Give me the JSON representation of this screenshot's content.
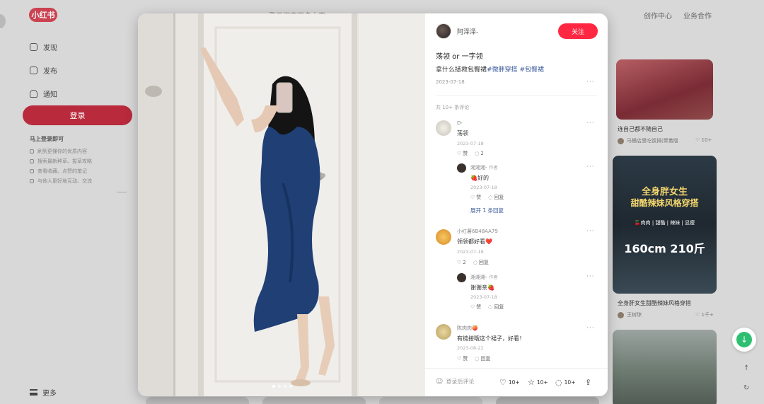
{
  "app": {
    "logo": "小红书"
  },
  "topnav": {
    "search_placeholder": "登录探索更多内容",
    "creator": "创作中心",
    "business": "业务合作"
  },
  "sidebar": {
    "items": [
      {
        "label": "发现",
        "icon": "home-icon"
      },
      {
        "label": "发布",
        "icon": "plus-square-icon"
      },
      {
        "label": "通知",
        "icon": "bell-icon"
      }
    ],
    "login_button": "登录",
    "login_tip_title": "马上登录即可",
    "login_tips": [
      "刷到更懂你的优质内容",
      "搜索最新种草、拔草攻略",
      "查看收藏、点赞的笔记",
      "与他人更好地互动、交流"
    ],
    "more": "更多"
  },
  "feed": {
    "cards": [
      {
        "title": "连自己都不随自己",
        "author": "马桶店里吃饭捐(聚着版",
        "likes": "10+"
      },
      {
        "banner_line1": "全身胖女生",
        "banner_line2": "甜酷辣妹风格穿搭",
        "banner_tags": "🍒肉肉 | 甜酷 | 辣妹 | 显瘦",
        "banner_size": "160cm 210斤",
        "title": "全身肝女生甜酷辣妹风格穿搭",
        "author": "王树琼",
        "likes": "1千+"
      }
    ]
  },
  "note": {
    "author": {
      "name": "阿泽泽-"
    },
    "follow_label": "关注",
    "title": "荡领 or 一字领",
    "body_text": "拿什么拯救包臀裙",
    "tags": [
      "#微胖穿搭",
      "#包臀裙"
    ],
    "date": "2023-07-18",
    "more": "···",
    "comment_count": "共 10+ 条评论",
    "comments": [
      {
        "name": "D-",
        "text": "荡领",
        "date": "2023-07-18",
        "likes": "赞",
        "replies": "2",
        "reply": {
          "name": "湘湘湘-",
          "author_tag": "作者",
          "text": "🍓好的",
          "date": "2023-07-18",
          "likes": "赞",
          "reply_label": "回复"
        },
        "expand": "展开 1 条回复"
      },
      {
        "name": "小红薯6B48AA79",
        "text": "领领都好看❤️",
        "date": "2023-07-18",
        "likes": "2",
        "replies": "回复",
        "reply": {
          "name": "湘湘湘-",
          "author_tag": "作者",
          "text": "谢谢亲🍓",
          "date": "2023-07-18",
          "likes": "赞",
          "reply_label": "回复"
        }
      },
      {
        "name": "陈肉肉🍑",
        "text": "有链接哦这个裙子，好看！",
        "date": "2023-08-22",
        "likes": "赞",
        "replies": "回复"
      }
    ],
    "footer": {
      "comment_placeholder": "登录后评论",
      "likes": "10+",
      "collects": "10+",
      "comments": "10+"
    }
  },
  "colors": {
    "brand": "#ff2741",
    "download": "#2fbf71"
  }
}
